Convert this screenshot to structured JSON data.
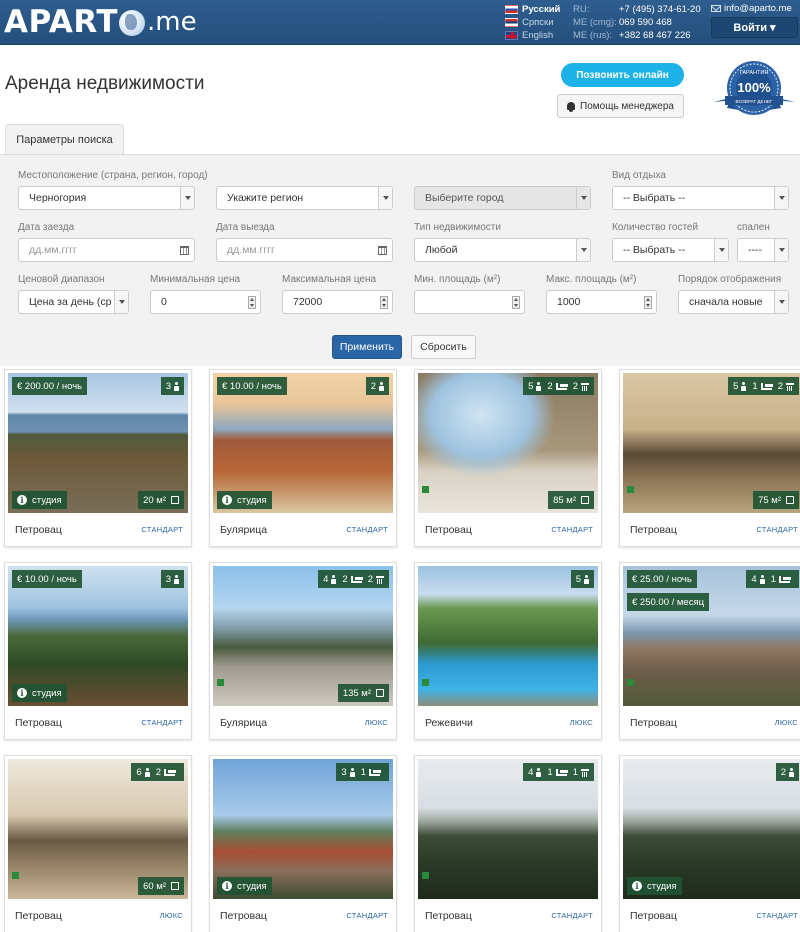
{
  "header": {
    "logo_main": "APART",
    "logo_tld": ".me",
    "languages": [
      {
        "label": "Русский",
        "flag": "ru-flag-icon"
      },
      {
        "label": "Српски",
        "flag": "rs-flag-icon"
      },
      {
        "label": "English",
        "flag": "gb-flag-icon"
      }
    ],
    "phones": [
      {
        "label": "RU:",
        "number": "+7 (495) 374-61-20"
      },
      {
        "label": "ME (cmg):",
        "number": "069 590 468"
      },
      {
        "label": "ME (rus):",
        "number": "+382 68 467 226"
      }
    ],
    "email": "info@aparto.me",
    "login_label": "Войти ▾"
  },
  "page": {
    "title": "Аренда недвижимости",
    "online_button": "Позвонить онлайн",
    "help_button": "Помощь менеджера",
    "badge": {
      "top_text": "ГАРАНТИЯ",
      "main_text": "100%",
      "bottom_text": "ВОЗВРАТ ДЕНЕГ"
    }
  },
  "search": {
    "tab_label": "Параметры поиска",
    "location": {
      "label": "Местоположение (страна, регион, город)",
      "value": "Черногория",
      "region": "Укажите регион",
      "city": "Выберите город"
    },
    "rest_type": {
      "label": "Вид отдыха",
      "value": "-- Выбрать --"
    },
    "checkin": {
      "label": "Дата заезда",
      "placeholder": "дд.мм.гггг"
    },
    "checkout": {
      "label": "Дата выезда",
      "placeholder": "дд.мм.гггг"
    },
    "property_type": {
      "label": "Тип недвижимости",
      "value": "Любой"
    },
    "guests": {
      "label": "Количество гостей",
      "value": "-- Выбрать --"
    },
    "bedrooms": {
      "label": "спален",
      "value": "----"
    },
    "price_range": {
      "label": "Ценовой диапазон",
      "value": "Цена за день (ср"
    },
    "min_price": {
      "label": "Минимальная цена",
      "value": "0"
    },
    "max_price": {
      "label": "Максимальная цена",
      "value": "72000"
    },
    "min_area": {
      "label": "Мин. площадь (м²)",
      "value": ""
    },
    "max_area": {
      "label": "Макс. площадь (м²)",
      "value": "1000"
    },
    "sort": {
      "label": "Порядок отображения",
      "value": "сначала новые"
    },
    "apply_label": "Применить",
    "reset_label": "Сбросить"
  },
  "listings": [
    {
      "city": "Петровац",
      "category": "СТАНДАРТ",
      "price": "€ 200.00 / ночь",
      "guests": "3",
      "bedrooms": "",
      "bathrooms": "",
      "studio": "студия",
      "area": "20 м²",
      "scene": "balcony-sea"
    },
    {
      "city": "Булярица",
      "category": "СТАНДАРТ",
      "price": "€ 10.00 / ночь",
      "guests": "2",
      "bedrooms": "",
      "bathrooms": "",
      "studio": "студия",
      "area": "",
      "scene": "balcony-dusk"
    },
    {
      "city": "Петровац",
      "category": "СТАНДАРТ",
      "price": "",
      "guests": "5",
      "bedrooms": "2",
      "bathrooms": "2",
      "studio": "",
      "area": "85 м²",
      "scene": "terrace-arch"
    },
    {
      "city": "Петровац",
      "category": "СТАНДАРТ",
      "price": "",
      "guests": "5",
      "bedrooms": "1",
      "bathrooms": "2",
      "studio": "",
      "area": "75 м²",
      "scene": "living-room"
    },
    {
      "city": "Петровац",
      "category": "СТАНДАРТ",
      "price": "€ 10.00 / ночь",
      "guests": "3",
      "bedrooms": "",
      "bathrooms": "",
      "studio": "студия",
      "area": "",
      "scene": "garden-sea"
    },
    {
      "city": "Булярица",
      "category": "ЛЮКС",
      "price": "",
      "guests": "4",
      "bedrooms": "2",
      "bathrooms": "2",
      "studio": "",
      "area": "135 м²",
      "scene": "terrace-chairs"
    },
    {
      "city": "Режевичи",
      "category": "ЛЮКС",
      "price": "",
      "guests": "5",
      "bedrooms": "",
      "bathrooms": "",
      "studio": "",
      "area": "",
      "scene": "pool"
    },
    {
      "city": "Петровац",
      "category": "ЛЮКС",
      "price": "€ 25.00 / ночь",
      "price2": "€ 250.00 / месяц",
      "guests": "4",
      "bedrooms": "1",
      "bathrooms": "",
      "studio": "",
      "area": "",
      "scene": "town-view"
    },
    {
      "city": "Петровац",
      "category": "ЛЮКС",
      "price": "",
      "guests": "6",
      "bedrooms": "2",
      "bathrooms": "",
      "studio": "",
      "area": "60 м²",
      "scene": "interior"
    },
    {
      "city": "Петровац",
      "category": "СТАНДАРТ",
      "price": "",
      "guests": "3",
      "bedrooms": "1",
      "bathrooms": "",
      "studio": "студия",
      "area": "",
      "scene": "rooftops"
    },
    {
      "city": "Петровац",
      "category": "СТАНДАРТ",
      "price": "",
      "guests": "4",
      "bedrooms": "1",
      "bathrooms": "1",
      "studio": "",
      "area": "",
      "scene": "hills"
    },
    {
      "city": "Петровац",
      "category": "СТАНДАРТ",
      "price": "",
      "guests": "2",
      "bedrooms": "",
      "bathrooms": "",
      "studio": "студия",
      "area": "",
      "scene": "hills"
    }
  ],
  "colors": {
    "header": "#2e5d8f",
    "accent": "#1db3e8",
    "apply": "#2a66a6",
    "tag": "#1f5433"
  }
}
